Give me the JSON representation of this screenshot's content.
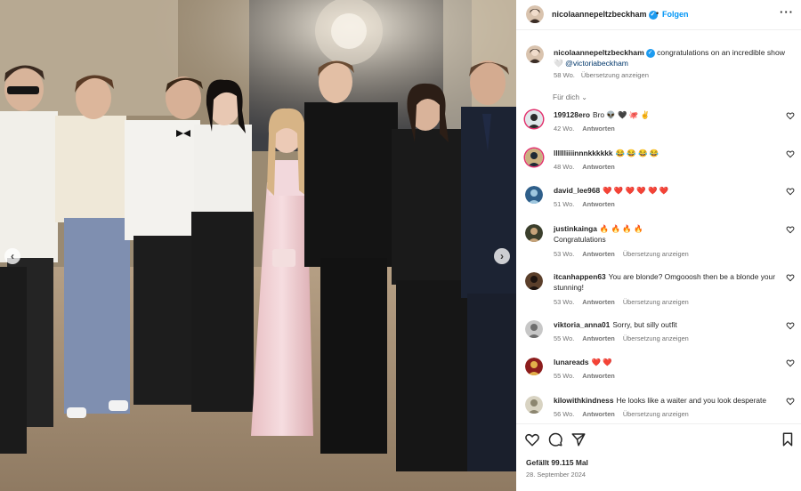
{
  "post": {
    "author": "nicolaannepeltzbeckham",
    "follow_label": "Folgen",
    "caption_text": "congratulations on an incredible show",
    "caption_heart": "🤍",
    "caption_mention": "@victoriabeckham",
    "caption_age": "58 Wo.",
    "caption_translate": "Übersetzung anzeigen",
    "sort_label": "Für dich",
    "likes_text": "Gefällt 99.115 Mal",
    "date_text": "28. September 2024"
  },
  "icons": {
    "more": "more-options-icon",
    "verified": "verified-badge-icon",
    "like": "heart-icon",
    "comment": "comment-bubble-icon",
    "share": "paper-plane-icon",
    "save": "bookmark-icon",
    "prev": "chevron-left-icon",
    "next": "chevron-right-icon"
  },
  "colors": {
    "link_blue": "#0095f6",
    "mention_blue": "#00376b",
    "muted": "#737373",
    "text": "#262626",
    "verified": "#1d9bf0"
  },
  "comments": [
    {
      "user": "199128ero",
      "text": "Bro 👽 🖤 🐙 ✌️",
      "age": "42 Wo.",
      "reply": "Antworten",
      "translate": ""
    },
    {
      "user": "lllllliiiinnnkkkkkk",
      "text": "😂 😂 😂 😂",
      "age": "48 Wo.",
      "reply": "Antworten",
      "translate": ""
    },
    {
      "user": "david_lee968",
      "text": "❤️ ❤️ ❤️ ❤️ ❤️ ❤️",
      "age": "51 Wo.",
      "reply": "Antworten",
      "translate": ""
    },
    {
      "user": "justinkainga",
      "text": "🔥 🔥 🔥 🔥\nCongratulations",
      "age": "53 Wo.",
      "reply": "Antworten",
      "translate": "Übersetzung anzeigen"
    },
    {
      "user": "itcanhappen63",
      "text": "You are blonde? Omgooosh then be a blonde your stunning!",
      "age": "53 Wo.",
      "reply": "Antworten",
      "translate": "Übersetzung anzeigen"
    },
    {
      "user": "viktoria_anna01",
      "text": "Sorry, but silly outfit",
      "age": "55 Wo.",
      "reply": "Antworten",
      "translate": "Übersetzung anzeigen"
    },
    {
      "user": "lunareads",
      "text": "❤️ ❤️",
      "age": "55 Wo.",
      "reply": "Antworten",
      "translate": ""
    },
    {
      "user": "kilowithkindness",
      "text": "He looks like a waiter and you look desperate",
      "age": "56 Wo.",
      "reply": "Antworten",
      "translate": "Übersetzung anzeigen"
    }
  ]
}
